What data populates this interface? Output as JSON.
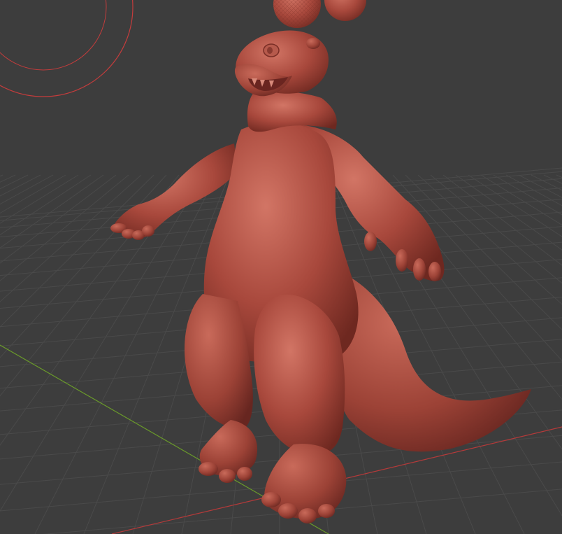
{
  "viewport": {
    "background": "#3d3d3d",
    "grid_color": "#4a4a4a",
    "x_axis_color": "#b53a3a",
    "y_axis_color": "#6a9a2a",
    "cursor_circle_color": "#c43c3c"
  },
  "model": {
    "material_color": "#a8483c",
    "shadow_color": "#7a2e26",
    "highlight_color": "#d07060"
  }
}
